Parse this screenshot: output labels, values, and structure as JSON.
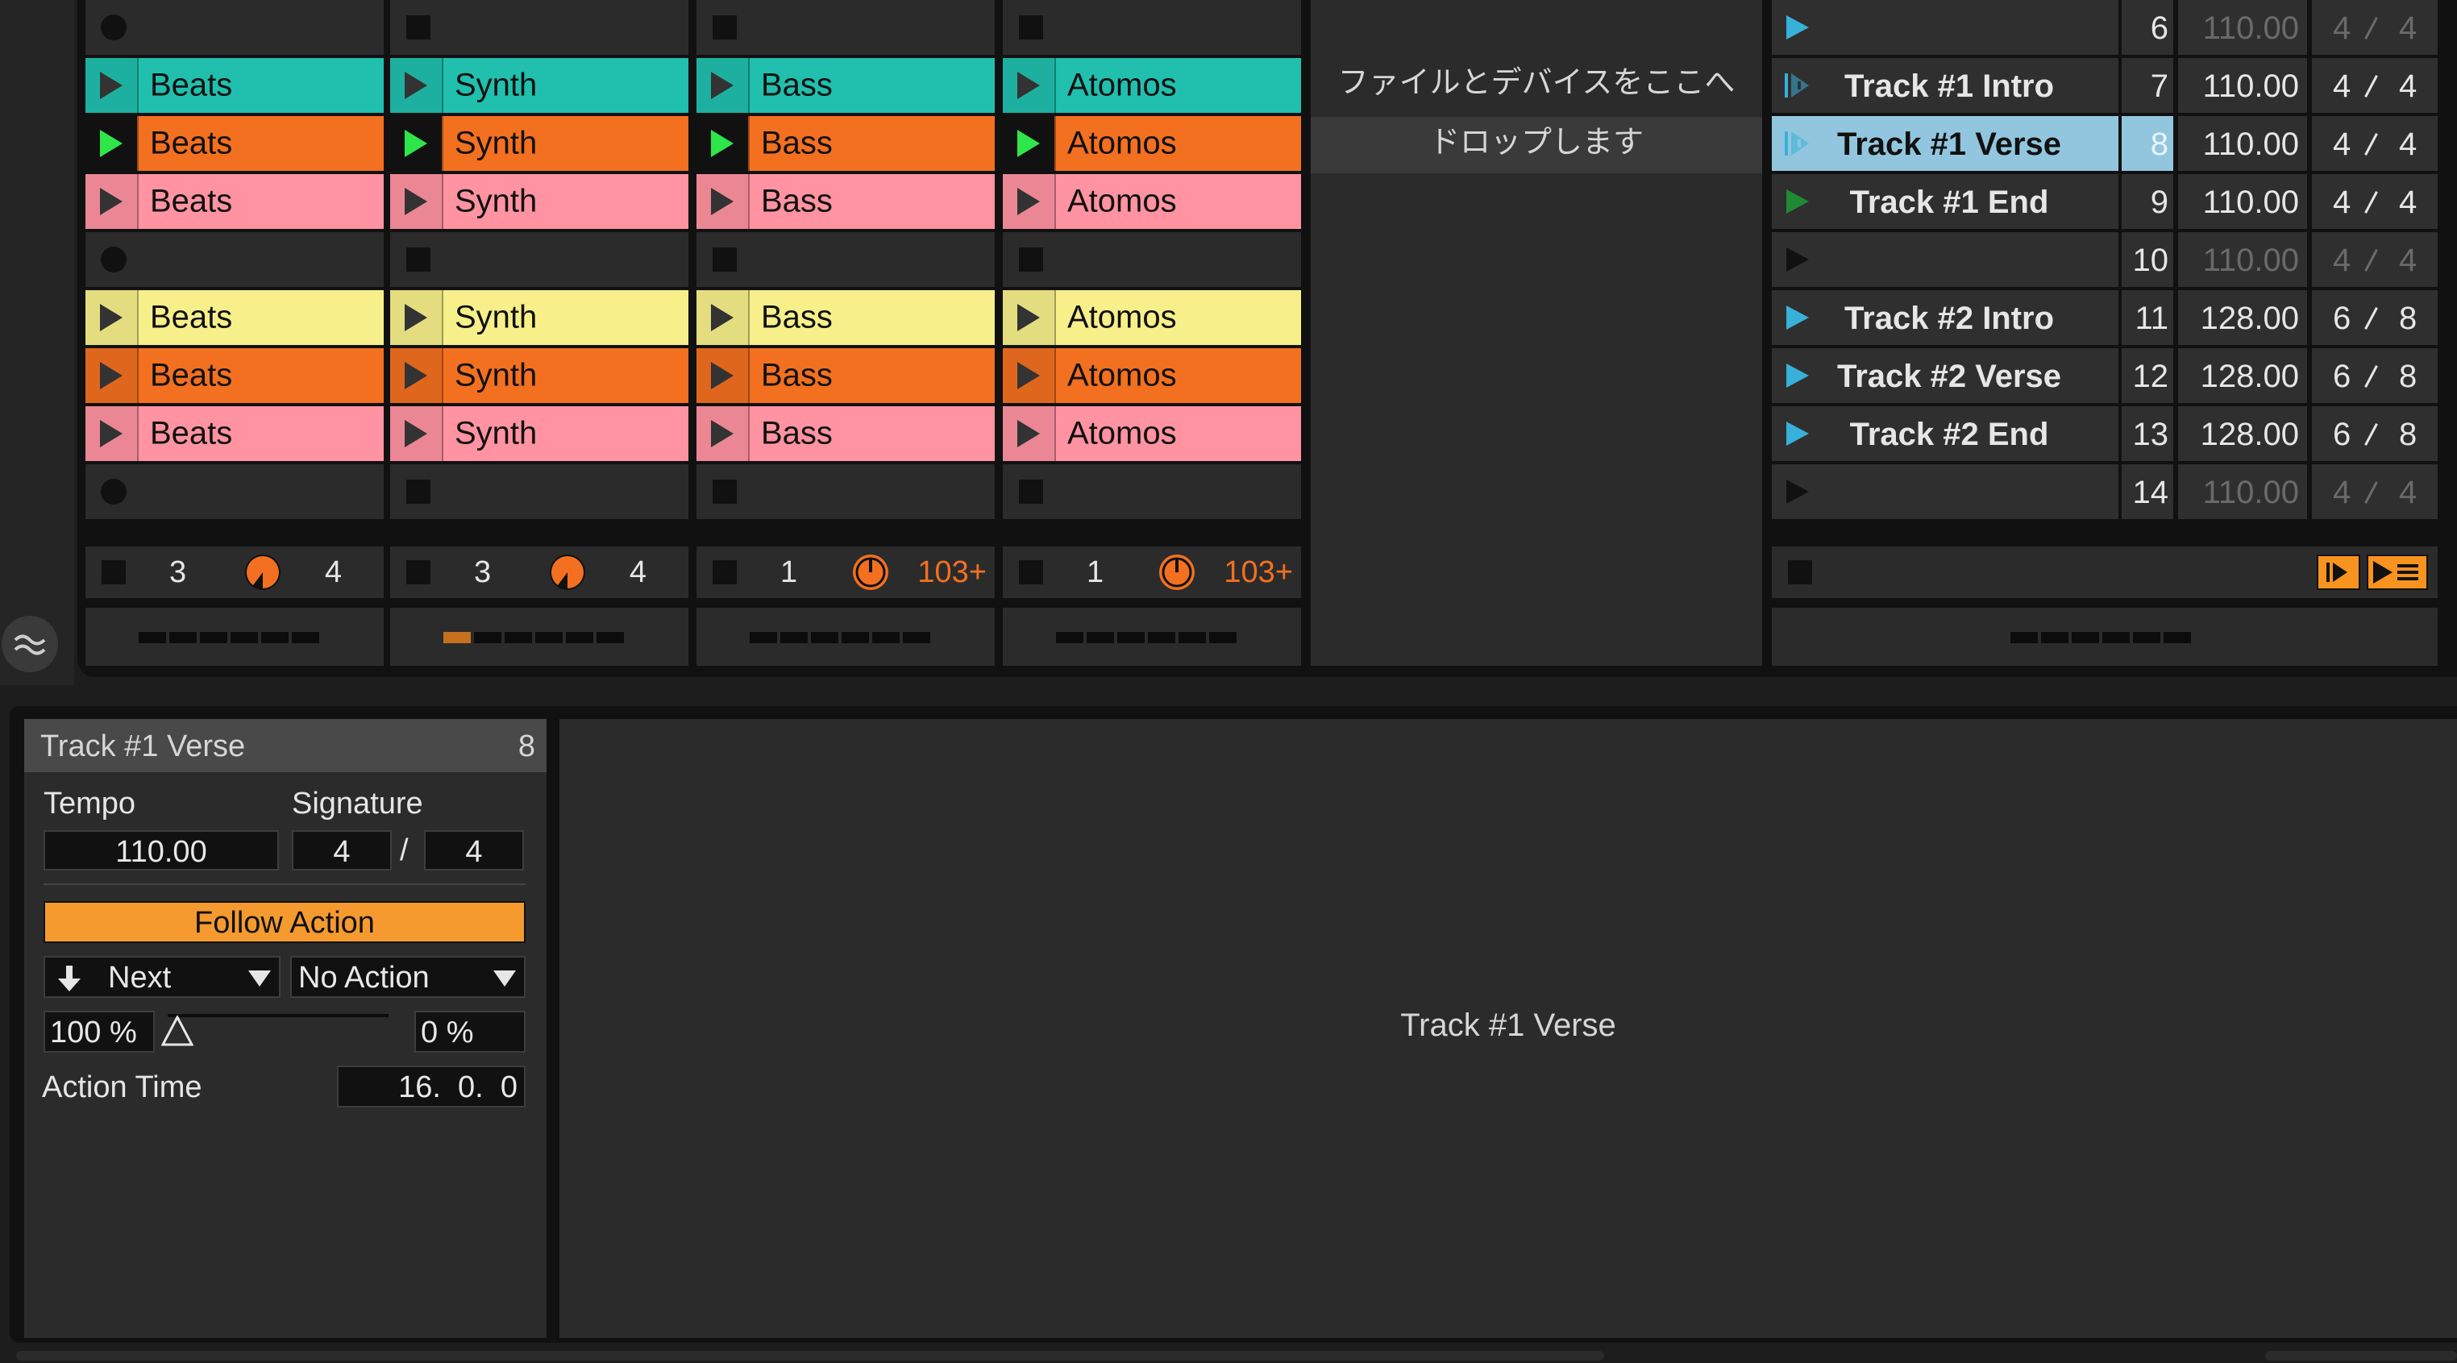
{
  "colors": {
    "teal": "#20bfae",
    "orange": "#f27020",
    "pink": "#ff93a1",
    "yellow": "#f7f08a",
    "blue_active": "#37b1d9",
    "scene_selected": "#91c6de",
    "follow_action": "#f59a2f"
  },
  "tracks": [
    {
      "clips": [
        "",
        "Beats",
        "Beats",
        "Beats",
        "",
        "Beats",
        "Beats",
        "Beats",
        ""
      ],
      "stop_mode": "dot",
      "ctrl": {
        "left": "3",
        "right": "4",
        "right_orange": false
      },
      "meter_active": false
    },
    {
      "clips": [
        "",
        "Synth",
        "Synth",
        "Synth",
        "",
        "Synth",
        "Synth",
        "Synth",
        ""
      ],
      "stop_mode": "square",
      "ctrl": {
        "left": "3",
        "right": "4",
        "right_orange": false
      },
      "meter_active": true
    },
    {
      "clips": [
        "",
        "Bass",
        "Bass",
        "Bass",
        "",
        "Bass",
        "Bass",
        "Bass",
        ""
      ],
      "stop_mode": "square",
      "ctrl": {
        "left": "1",
        "right": "103+",
        "right_orange": true
      },
      "meter_active": false
    },
    {
      "clips": [
        "",
        "Atomos",
        "Atomos",
        "Atomos",
        "",
        "Atomos",
        "Atomos",
        "Atomos",
        ""
      ],
      "stop_mode": "square",
      "ctrl": {
        "left": "1",
        "right": "103+",
        "right_orange": true
      },
      "meter_active": false
    }
  ],
  "drop_zone": {
    "line1": "ファイルとデバイスをここへ",
    "line2": "ドロップします"
  },
  "scenes": [
    {
      "name": "",
      "num": "6",
      "tempo": "110.00",
      "sig_num": "4",
      "sig_den": "4",
      "dim": true,
      "play": "blue"
    },
    {
      "name": "Track #1 Intro",
      "num": "7",
      "tempo": "110.00",
      "sig_num": "4",
      "sig_den": "4",
      "dim": false,
      "play": "blue-follow"
    },
    {
      "name": "Track #1 Verse",
      "num": "8",
      "tempo": "110.00",
      "sig_num": "4",
      "sig_den": "4",
      "dim": false,
      "play": "blue-follow",
      "selected": true
    },
    {
      "name": "Track #1 End",
      "num": "9",
      "tempo": "110.00",
      "sig_num": "4",
      "sig_den": "4",
      "dim": false,
      "play": "green"
    },
    {
      "name": "",
      "num": "10",
      "tempo": "110.00",
      "sig_num": "4",
      "sig_den": "4",
      "dim": true,
      "play": "dark"
    },
    {
      "name": "Track #2 Intro",
      "num": "11",
      "tempo": "128.00",
      "sig_num": "6",
      "sig_den": "8",
      "dim": false,
      "play": "blue"
    },
    {
      "name": "Track #2 Verse",
      "num": "12",
      "tempo": "128.00",
      "sig_num": "6",
      "sig_den": "8",
      "dim": false,
      "play": "blue"
    },
    {
      "name": "Track #2 End",
      "num": "13",
      "tempo": "128.00",
      "sig_num": "6",
      "sig_den": "8",
      "dim": false,
      "play": "blue"
    },
    {
      "name": "",
      "num": "14",
      "tempo": "110.00",
      "sig_num": "4",
      "sig_den": "4",
      "dim": true,
      "play": "dark"
    }
  ],
  "detail": {
    "title": "Track #1 Verse",
    "scene_number": "8",
    "tempo_label": "Tempo",
    "signature_label": "Signature",
    "tempo_value": "110.00",
    "sig_num": "4",
    "sig_slash": "/",
    "sig_den": "4",
    "follow_action_label": "Follow Action",
    "action_a": "Next",
    "action_b": "No Action",
    "chance_a": "100 %",
    "chance_b": "0 %",
    "chance_a_fraction": 1.0,
    "action_time_label": "Action Time",
    "action_time": "16.  0.  0"
  },
  "main_panel": {
    "label": "Track #1 Verse"
  },
  "icons": {
    "hide_icon": "wave-toggle-icon",
    "follow_icon": "follow-action-icon",
    "queue_icon": "queue-icon",
    "arrow_down_icon": "arrow-down-icon"
  }
}
